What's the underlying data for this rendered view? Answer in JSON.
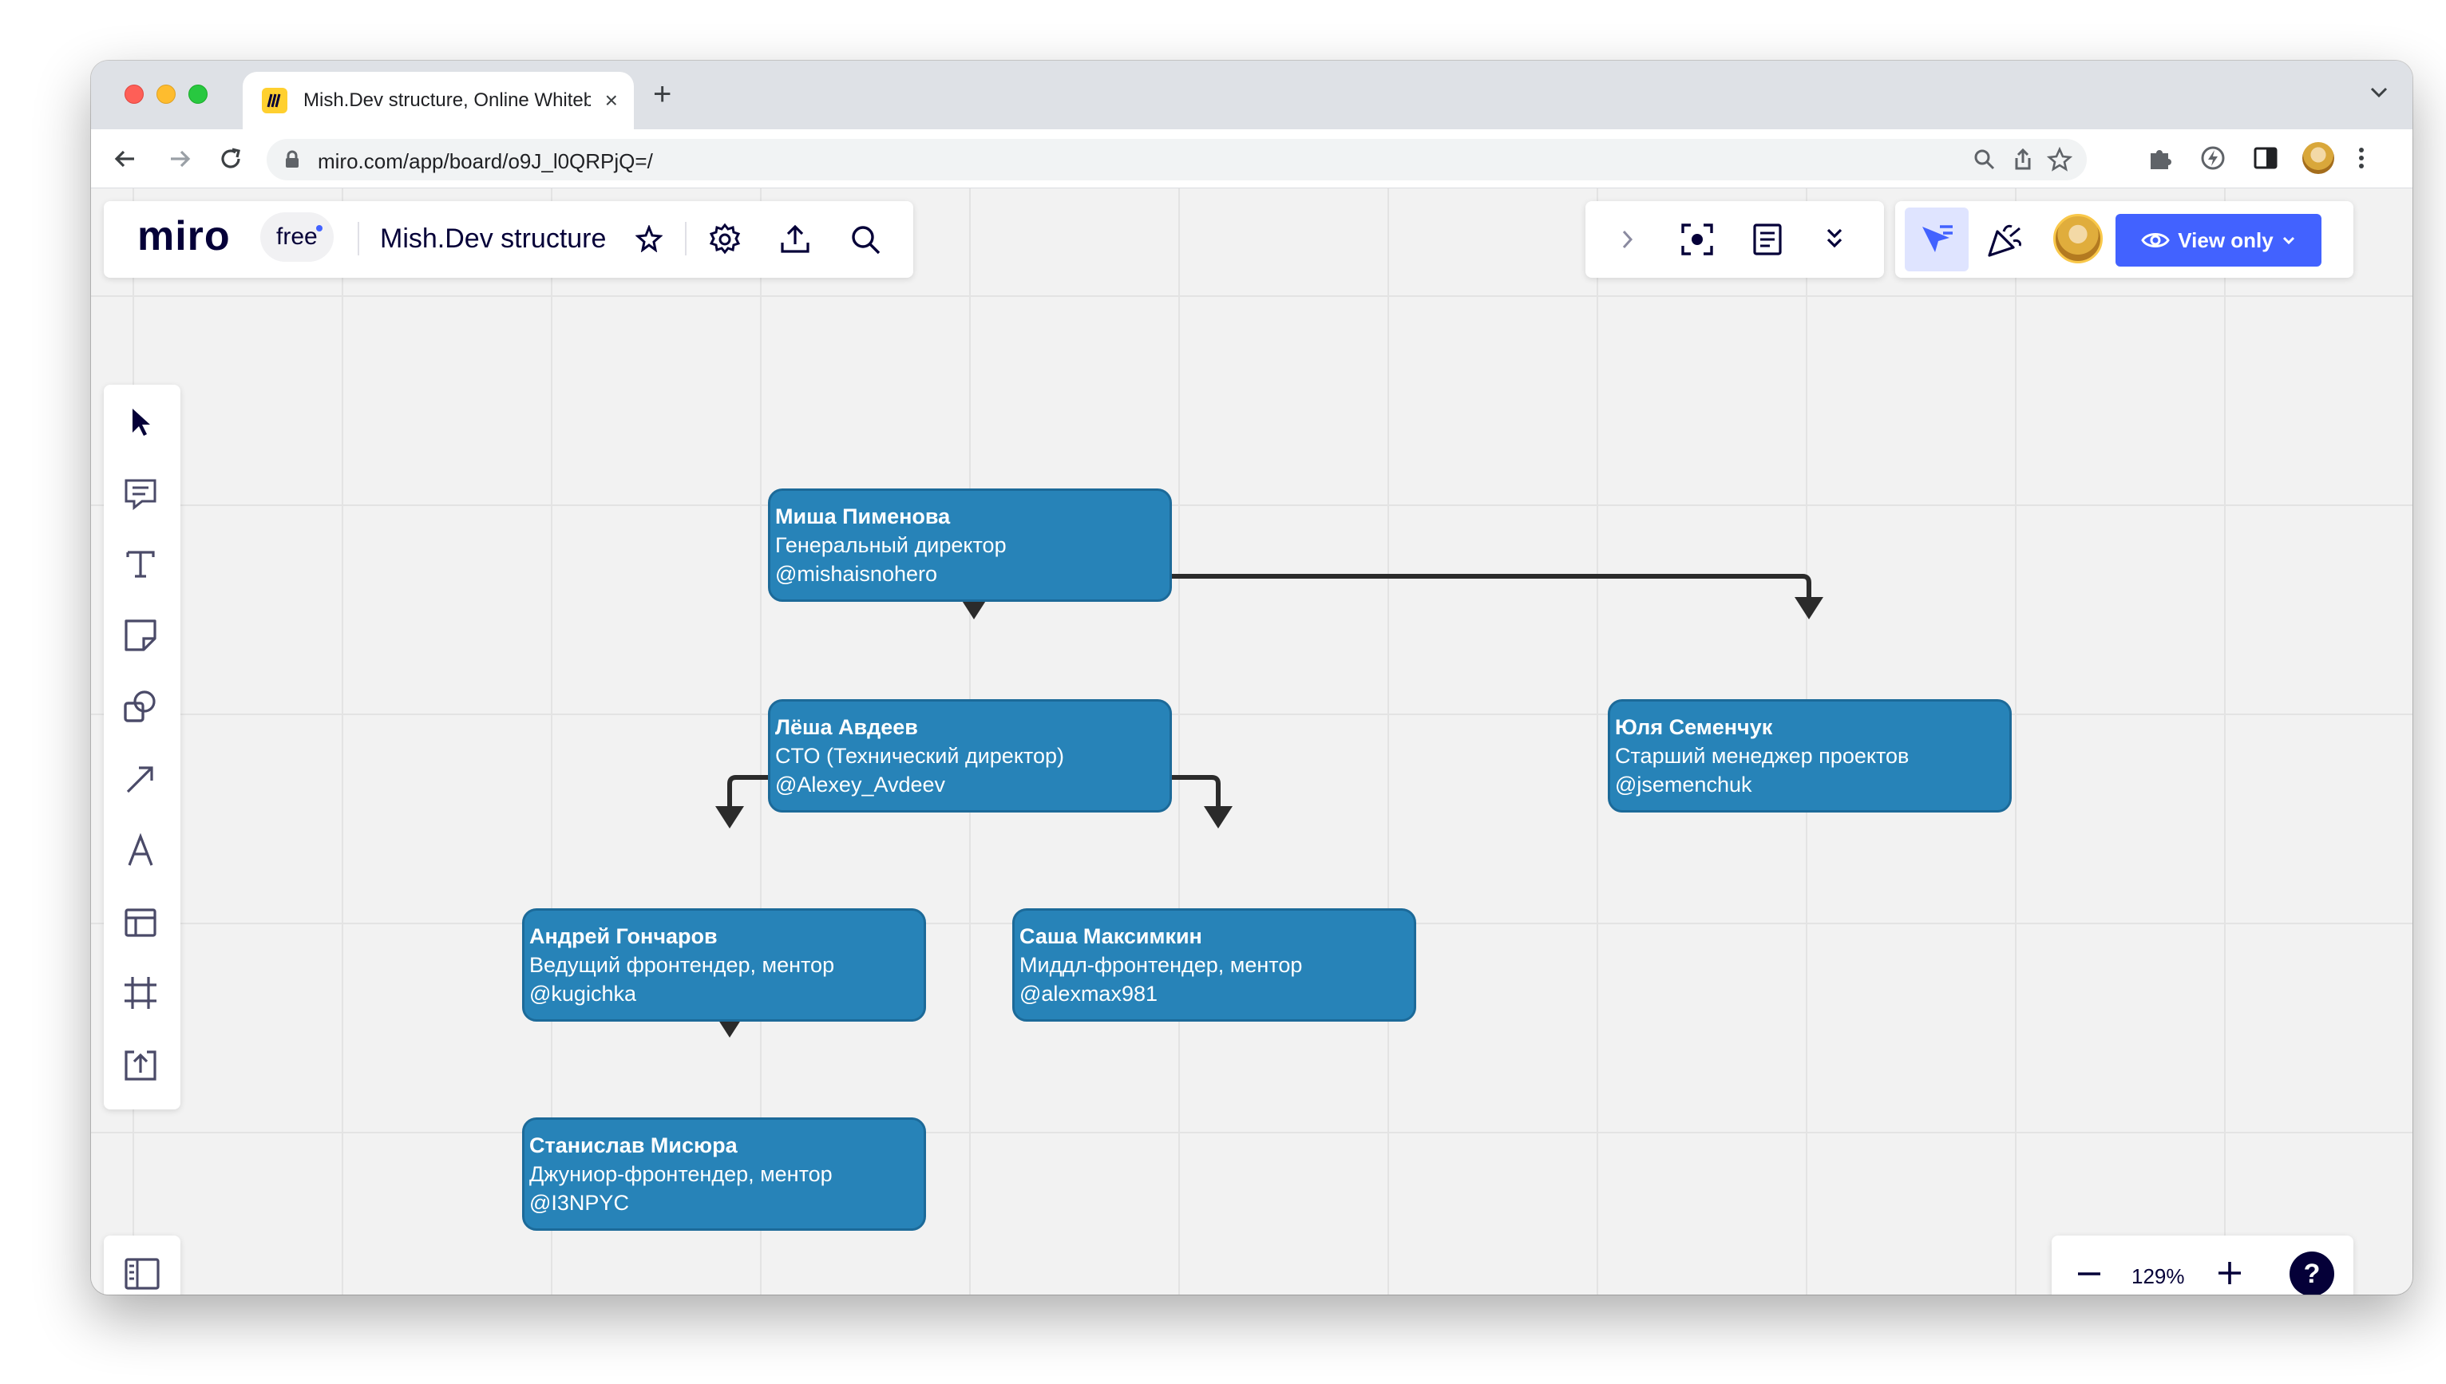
{
  "browser": {
    "tab_title": "Mish.Dev structure, Online Whiteboard",
    "url": "miro.com/app/board/o9J_l0QRPjQ=/"
  },
  "topbar": {
    "logo": "miro",
    "plan_badge": "free",
    "board_title": "Mish.Dev structure",
    "view_mode_label": "View only"
  },
  "zoom": {
    "level": "129%"
  },
  "help": {
    "label": "?"
  },
  "org_chart": {
    "nodes": [
      {
        "name": "Миша Пименова",
        "role": "Генеральный директор",
        "handle": "@mishaisnohero"
      },
      {
        "name": "Лёша Авдеев",
        "role": "CTO (Технический директор)",
        "handle": "@Alexey_Avdeev"
      },
      {
        "name": "Юля Семенчук",
        "role": "Старший менеджер проектов",
        "handle": "@jsemenchuk"
      },
      {
        "name": "Андрей Гончаров",
        "role": "Ведущий фронтендер, ментор",
        "handle": "@kugichka"
      },
      {
        "name": "Саша Максимкин",
        "role": "Миддл-фронтендер, ментор",
        "handle": "@alexmax981"
      },
      {
        "name": "Станислав Мисюра",
        "role": "Джуниор-фронтендер, ментор",
        "handle": "@I3NPYC"
      }
    ]
  },
  "colors": {
    "node_fill": "#2783b8",
    "node_border": "#1c6a99",
    "connector": "#2b2b2b",
    "accent": "#4262ff"
  }
}
